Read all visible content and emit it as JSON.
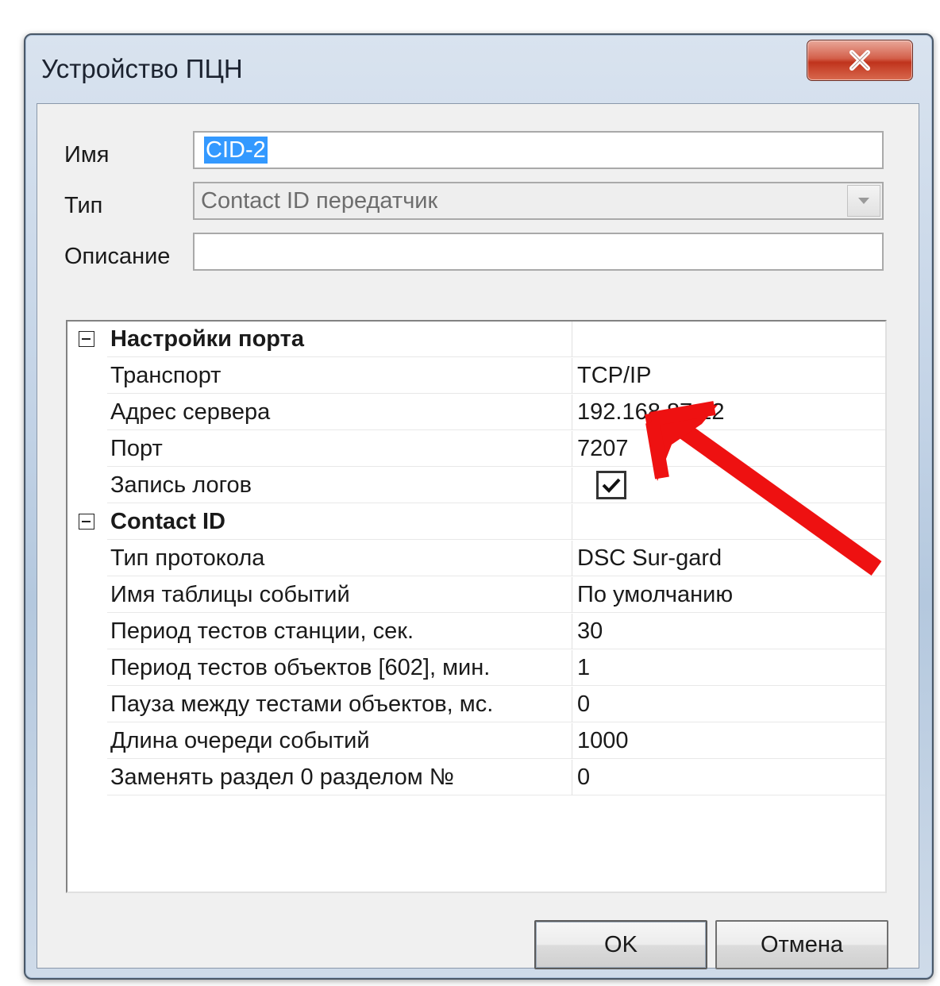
{
  "window": {
    "title": "Устройство ПЦН"
  },
  "form": {
    "name_label": "Имя",
    "name_value": "CID-2",
    "type_label": "Тип",
    "type_value": "Contact ID передатчик",
    "description_label": "Описание",
    "description_value": ""
  },
  "property_grid": {
    "port_settings": {
      "category": "Настройки порта",
      "rows": [
        {
          "name": "Транспорт",
          "value": "TCP/IP"
        },
        {
          "name": "Адрес сервера",
          "value": "192.168.87.22"
        },
        {
          "name": "Порт",
          "value": "7207"
        },
        {
          "name": "Запись логов",
          "checked": true
        }
      ]
    },
    "contact_id": {
      "category": "Contact ID",
      "rows": [
        {
          "name": "Тип протокола",
          "value": "DSC Sur-gard"
        },
        {
          "name": "Имя таблицы событий",
          "value": "По умолчанию"
        },
        {
          "name": "Период тестов станции, сек.",
          "value": "30"
        },
        {
          "name": "Период тестов объектов [602], мин.",
          "value": "1"
        },
        {
          "name": "Пауза между тестами объектов, мс.",
          "value": "0"
        },
        {
          "name": "Длина очереди событий",
          "value": "1000"
        },
        {
          "name": "Заменять раздел 0 разделом №",
          "value": "0"
        }
      ]
    }
  },
  "buttons": {
    "ok": "OK",
    "cancel": "Отмена"
  },
  "icons": {
    "close": "close-icon",
    "dropdown": "chevron-down-icon",
    "collapse": "collapse-icon",
    "check": "checkmark-icon",
    "annotation": "red-arrow-icon"
  },
  "colors": {
    "selection": "#3399ff",
    "close_button": "#c8452f",
    "annotation_arrow": "#ee1111"
  }
}
